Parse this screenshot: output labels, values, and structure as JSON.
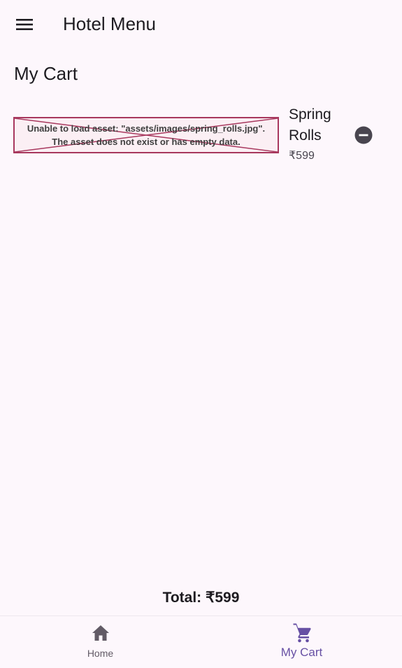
{
  "app_bar": {
    "title": "Hotel Menu",
    "menu_icon": "menu-icon"
  },
  "page": {
    "title": "My Cart"
  },
  "cart": {
    "items": [
      {
        "image_error_line1": "Unable to load asset: \"assets/images/spring_rolls.jpg\".",
        "image_error_line2": "The asset does not exist or has empty data.",
        "name": "Spring Rolls",
        "price": "₹599",
        "remove_icon": "remove-circle-icon"
      }
    ],
    "total": "Total: ₹599"
  },
  "bottom_nav": {
    "items": [
      {
        "label": "Home",
        "icon": "home-icon",
        "selected": false
      },
      {
        "label": "My Cart",
        "icon": "shopping-cart-icon",
        "selected": true
      }
    ]
  },
  "colors": {
    "background": "#fdf7fc",
    "accent": "#6750a4",
    "error_border": "#a8385e",
    "icon_dark": "#49454f"
  }
}
